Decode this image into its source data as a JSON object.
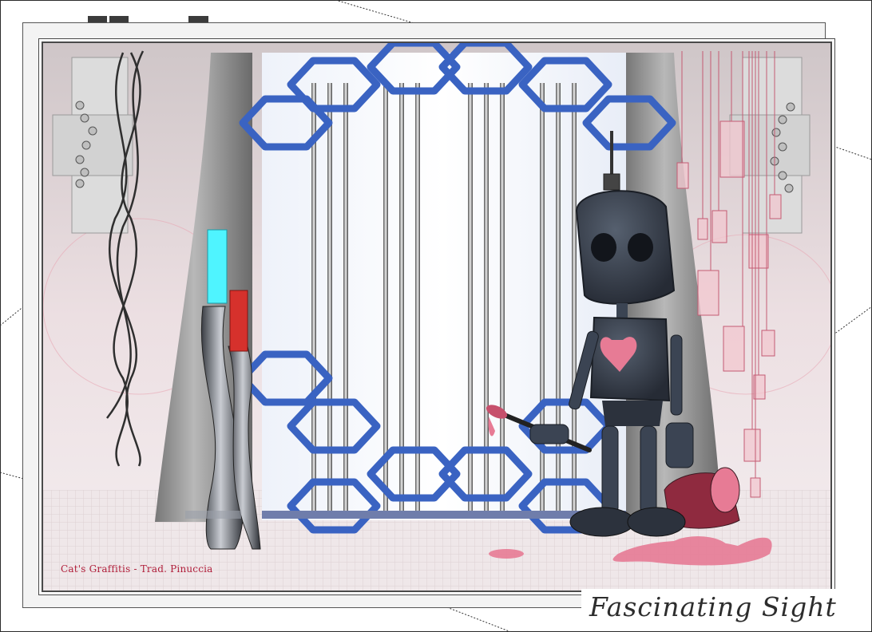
{
  "credit": "Cat's Graffitis - Trad. Pinuccia",
  "title": "Fascinating Sight",
  "icons": [
    "robot",
    "paint-brush",
    "paint-can",
    "vase",
    "candle",
    "hexagon-door",
    "hanging-crystals",
    "wire-sculpture"
  ],
  "colors": {
    "accent_blue": "#3a63c2",
    "paint_pink": "#e77b95",
    "robot_grey": "#3b4453",
    "candle_cyan": "#4ff4ff",
    "candle_red": "#d6312c",
    "credit_red": "#b01e3a"
  }
}
